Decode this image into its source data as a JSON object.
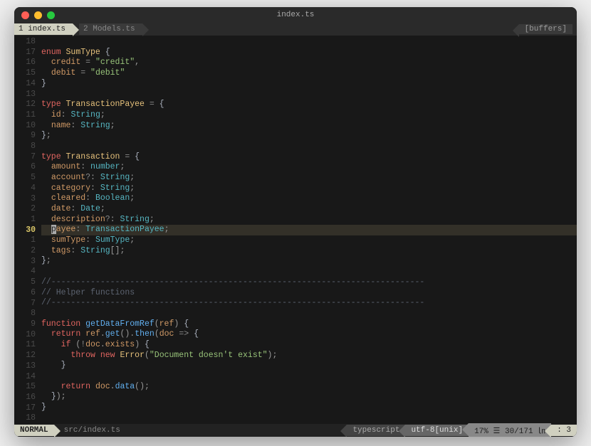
{
  "window": {
    "title": "index.ts"
  },
  "tabs": [
    {
      "label": "1 index.ts",
      "active": true
    },
    {
      "label": "2 Models.ts",
      "active": false
    }
  ],
  "buffers_label": "[buffers]",
  "gutter": [
    "18",
    "17",
    "16",
    "15",
    "14",
    "13",
    "12",
    "11",
    "10",
    "9",
    "8",
    "7",
    "6",
    "5",
    "4",
    "3",
    "2",
    "1",
    "30",
    "1",
    "2",
    "3",
    "4",
    "5",
    "6",
    "7",
    "8",
    "9",
    "10",
    "11",
    "12",
    "13",
    "14",
    "15",
    "16",
    "17",
    "18"
  ],
  "current_line_index": 18,
  "code": {
    "lines": [
      [],
      [
        [
          "kw",
          "enum"
        ],
        [
          "",
          ""
        ],
        [
          "type",
          " SumType"
        ],
        [
          "",
          " "
        ],
        [
          "brace",
          "{"
        ]
      ],
      [
        [
          "",
          "  "
        ],
        [
          "prop",
          "credit"
        ],
        [
          "",
          " "
        ],
        [
          "op",
          "="
        ],
        [
          "",
          " "
        ],
        [
          "str",
          "\"credit\""
        ],
        [
          "punct",
          ","
        ]
      ],
      [
        [
          "",
          "  "
        ],
        [
          "prop",
          "debit"
        ],
        [
          "",
          " "
        ],
        [
          "op",
          "="
        ],
        [
          "",
          " "
        ],
        [
          "str",
          "\"debit\""
        ]
      ],
      [
        [
          "brace",
          "}"
        ]
      ],
      [],
      [
        [
          "kw",
          "type"
        ],
        [
          "",
          " "
        ],
        [
          "type",
          "TransactionPayee"
        ],
        [
          "",
          " "
        ],
        [
          "op",
          "="
        ],
        [
          "",
          " "
        ],
        [
          "brace",
          "{"
        ]
      ],
      [
        [
          "",
          "  "
        ],
        [
          "prop",
          "id"
        ],
        [
          "punct",
          ":"
        ],
        [
          "",
          " "
        ],
        [
          "typename",
          "String"
        ],
        [
          "punct",
          ";"
        ]
      ],
      [
        [
          "",
          "  "
        ],
        [
          "prop",
          "name"
        ],
        [
          "punct",
          ":"
        ],
        [
          "",
          " "
        ],
        [
          "typename",
          "String"
        ],
        [
          "punct",
          ";"
        ]
      ],
      [
        [
          "brace",
          "}"
        ],
        [
          "punct",
          ";"
        ]
      ],
      [],
      [
        [
          "kw",
          "type"
        ],
        [
          "",
          " "
        ],
        [
          "type",
          "Transaction"
        ],
        [
          "",
          " "
        ],
        [
          "op",
          "="
        ],
        [
          "",
          " "
        ],
        [
          "brace",
          "{"
        ]
      ],
      [
        [
          "",
          "  "
        ],
        [
          "prop",
          "amount"
        ],
        [
          "punct",
          ":"
        ],
        [
          "",
          " "
        ],
        [
          "typename",
          "number"
        ],
        [
          "punct",
          ";"
        ]
      ],
      [
        [
          "",
          "  "
        ],
        [
          "prop",
          "account"
        ],
        [
          "op",
          "?"
        ],
        [
          "punct",
          ":"
        ],
        [
          "",
          " "
        ],
        [
          "typename",
          "String"
        ],
        [
          "punct",
          ";"
        ]
      ],
      [
        [
          "",
          "  "
        ],
        [
          "prop",
          "category"
        ],
        [
          "punct",
          ":"
        ],
        [
          "",
          " "
        ],
        [
          "typename",
          "String"
        ],
        [
          "punct",
          ";"
        ]
      ],
      [
        [
          "",
          "  "
        ],
        [
          "prop",
          "cleared"
        ],
        [
          "punct",
          ":"
        ],
        [
          "",
          " "
        ],
        [
          "typename",
          "Boolean"
        ],
        [
          "punct",
          ";"
        ]
      ],
      [
        [
          "",
          "  "
        ],
        [
          "prop",
          "date"
        ],
        [
          "punct",
          ":"
        ],
        [
          "",
          " "
        ],
        [
          "typename",
          "Date"
        ],
        [
          "punct",
          ";"
        ]
      ],
      [
        [
          "",
          "  "
        ],
        [
          "prop",
          "description"
        ],
        [
          "op",
          "?"
        ],
        [
          "punct",
          ":"
        ],
        [
          "",
          " "
        ],
        [
          "typename",
          "String"
        ],
        [
          "punct",
          ";"
        ]
      ],
      [
        [
          "",
          "  "
        ],
        [
          "cursor",
          "p"
        ],
        [
          "prop",
          "ayee"
        ],
        [
          "punct",
          ":"
        ],
        [
          "",
          " "
        ],
        [
          "typename",
          "TransactionPayee"
        ],
        [
          "punct",
          ";"
        ]
      ],
      [
        [
          "",
          "  "
        ],
        [
          "prop",
          "sumType"
        ],
        [
          "punct",
          ":"
        ],
        [
          "",
          " "
        ],
        [
          "typename",
          "SumType"
        ],
        [
          "punct",
          ";"
        ]
      ],
      [
        [
          "",
          "  "
        ],
        [
          "prop",
          "tags"
        ],
        [
          "punct",
          ":"
        ],
        [
          "",
          " "
        ],
        [
          "typename",
          "String"
        ],
        [
          "punct",
          "[]"
        ],
        [
          "punct",
          ";"
        ]
      ],
      [
        [
          "brace",
          "}"
        ],
        [
          "punct",
          ";"
        ]
      ],
      [],
      [
        [
          "comment",
          "//----------------------------------------------------------------------------"
        ]
      ],
      [
        [
          "comment",
          "// Helper functions"
        ]
      ],
      [
        [
          "comment",
          "//----------------------------------------------------------------------------"
        ]
      ],
      [],
      [
        [
          "kw",
          "function"
        ],
        [
          "",
          " "
        ],
        [
          "fn",
          "getDataFromRef"
        ],
        [
          "punct",
          "("
        ],
        [
          "prop",
          "ref"
        ],
        [
          "punct",
          ")"
        ],
        [
          "",
          " "
        ],
        [
          "brace",
          "{"
        ]
      ],
      [
        [
          "",
          "  "
        ],
        [
          "kw",
          "return"
        ],
        [
          "",
          " "
        ],
        [
          "prop",
          "ref"
        ],
        [
          "punct",
          "."
        ],
        [
          "fn",
          "get"
        ],
        [
          "punct",
          "()"
        ],
        [
          "punct",
          "."
        ],
        [
          "fn",
          "then"
        ],
        [
          "punct",
          "("
        ],
        [
          "prop",
          "doc"
        ],
        [
          "",
          " "
        ],
        [
          "op",
          "=>"
        ],
        [
          "",
          " "
        ],
        [
          "brace",
          "{"
        ]
      ],
      [
        [
          "",
          "    "
        ],
        [
          "kw",
          "if"
        ],
        [
          "",
          " "
        ],
        [
          "punct",
          "("
        ],
        [
          "op",
          "!"
        ],
        [
          "prop",
          "doc"
        ],
        [
          "punct",
          "."
        ],
        [
          "prop",
          "exists"
        ],
        [
          "punct",
          ")"
        ],
        [
          "",
          " "
        ],
        [
          "brace",
          "{"
        ]
      ],
      [
        [
          "",
          "      "
        ],
        [
          "kw",
          "throw"
        ],
        [
          "",
          " "
        ],
        [
          "kw",
          "new"
        ],
        [
          "",
          " "
        ],
        [
          "type",
          "Error"
        ],
        [
          "punct",
          "("
        ],
        [
          "str",
          "\"Document doesn't exist\""
        ],
        [
          "punct",
          ")"
        ],
        [
          "punct",
          ";"
        ]
      ],
      [
        [
          "",
          "    "
        ],
        [
          "brace",
          "}"
        ]
      ],
      [],
      [
        [
          "",
          "    "
        ],
        [
          "kw",
          "return"
        ],
        [
          "",
          " "
        ],
        [
          "prop",
          "doc"
        ],
        [
          "punct",
          "."
        ],
        [
          "fn",
          "data"
        ],
        [
          "punct",
          "()"
        ],
        [
          "punct",
          ";"
        ]
      ],
      [
        [
          "",
          "  "
        ],
        [
          "brace",
          "}"
        ],
        [
          "punct",
          ")"
        ],
        [
          "punct",
          ";"
        ]
      ],
      [
        [
          "brace",
          "}"
        ]
      ],
      []
    ]
  },
  "status": {
    "mode": "NORMAL",
    "filepath": "src/index.ts",
    "filetype": "typescript",
    "encoding": "utf-8[unix]",
    "percent": "17%",
    "position": "30/171",
    "col": "3"
  }
}
